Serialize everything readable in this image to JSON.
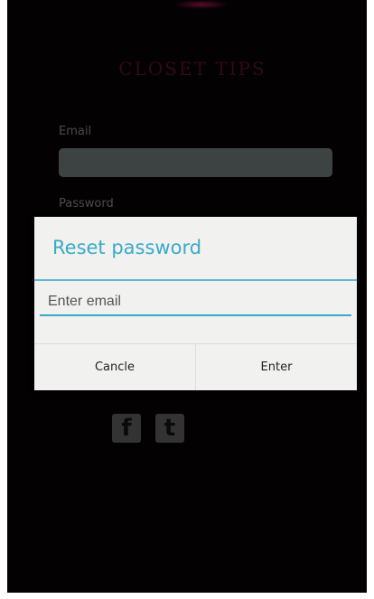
{
  "app": {
    "logo_text": "CLOSET TIPS"
  },
  "login_form": {
    "email_label": "Email",
    "password_label": "Password"
  },
  "social": {
    "facebook_glyph": "f",
    "twitter_glyph": "t",
    "facebook_icon": "facebook-icon",
    "twitter_icon": "twitter-icon"
  },
  "dialog": {
    "title": "Reset password",
    "email_placeholder": "Enter email",
    "cancel_label": "Cancle",
    "enter_label": "Enter"
  },
  "colors": {
    "accent": "#3ba9c9",
    "background": "#040103",
    "dialog_bg": "#f1f1ef"
  }
}
